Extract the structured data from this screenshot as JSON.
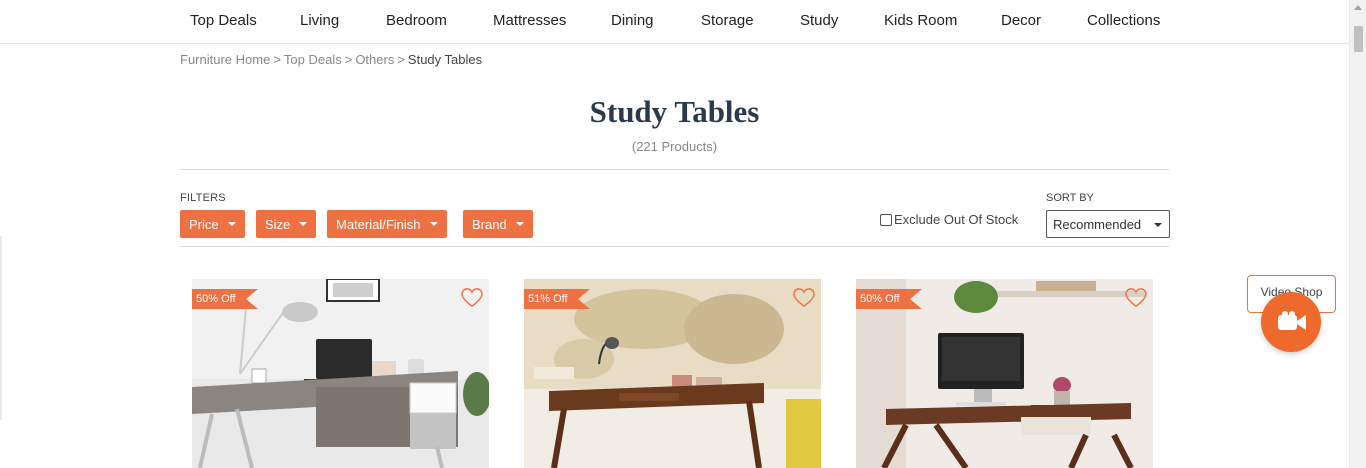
{
  "nav": {
    "items": [
      "Top Deals",
      "Living",
      "Bedroom",
      "Mattresses",
      "Dining",
      "Storage",
      "Study",
      "Kids Room",
      "Decor",
      "Collections"
    ]
  },
  "breadcrumb": {
    "items": [
      "Furniture Home",
      "Top Deals",
      "Others"
    ],
    "separator": ">",
    "current": "Study Tables"
  },
  "page": {
    "title": "Study Tables",
    "count": "(221 Products)"
  },
  "filters": {
    "label": "FILTERS",
    "buttons": [
      "Price",
      "Size",
      "Material/Finish",
      "Brand"
    ]
  },
  "exclude": {
    "label": "Exclude Out Of Stock",
    "checked": false
  },
  "sort": {
    "label": "SORT BY",
    "selected": "Recommended"
  },
  "products": [
    {
      "discount": "50% Off",
      "wishlist_icon": "heart-outline-icon"
    },
    {
      "discount": "51% Off",
      "wishlist_icon": "heart-outline-icon"
    },
    {
      "discount": "50% Off",
      "wishlist_icon": "heart-outline-icon"
    }
  ],
  "video_shop": {
    "label": "Video Shop",
    "icon": "video-camera-icon"
  },
  "colors": {
    "accent": "#ee7143",
    "title": "#2b3a4a"
  }
}
